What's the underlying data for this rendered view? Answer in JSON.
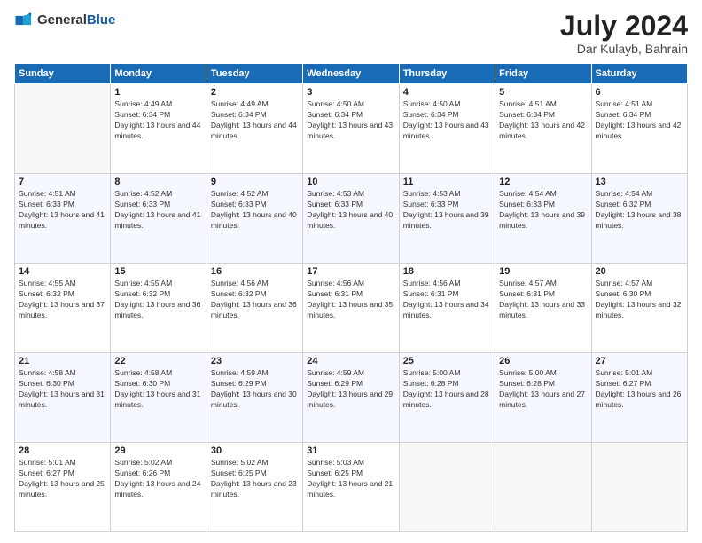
{
  "header": {
    "logo_general": "General",
    "logo_blue": "Blue",
    "month": "July 2024",
    "location": "Dar Kulayb, Bahrain"
  },
  "weekdays": [
    "Sunday",
    "Monday",
    "Tuesday",
    "Wednesday",
    "Thursday",
    "Friday",
    "Saturday"
  ],
  "weeks": [
    [
      {
        "day": "",
        "empty": true
      },
      {
        "day": "1",
        "sunrise": "4:49 AM",
        "sunset": "6:34 PM",
        "daylight": "13 hours and 44 minutes."
      },
      {
        "day": "2",
        "sunrise": "4:49 AM",
        "sunset": "6:34 PM",
        "daylight": "13 hours and 44 minutes."
      },
      {
        "day": "3",
        "sunrise": "4:50 AM",
        "sunset": "6:34 PM",
        "daylight": "13 hours and 43 minutes."
      },
      {
        "day": "4",
        "sunrise": "4:50 AM",
        "sunset": "6:34 PM",
        "daylight": "13 hours and 43 minutes."
      },
      {
        "day": "5",
        "sunrise": "4:51 AM",
        "sunset": "6:34 PM",
        "daylight": "13 hours and 42 minutes."
      },
      {
        "day": "6",
        "sunrise": "4:51 AM",
        "sunset": "6:34 PM",
        "daylight": "13 hours and 42 minutes."
      }
    ],
    [
      {
        "day": "7",
        "sunrise": "4:51 AM",
        "sunset": "6:33 PM",
        "daylight": "13 hours and 41 minutes."
      },
      {
        "day": "8",
        "sunrise": "4:52 AM",
        "sunset": "6:33 PM",
        "daylight": "13 hours and 41 minutes."
      },
      {
        "day": "9",
        "sunrise": "4:52 AM",
        "sunset": "6:33 PM",
        "daylight": "13 hours and 40 minutes."
      },
      {
        "day": "10",
        "sunrise": "4:53 AM",
        "sunset": "6:33 PM",
        "daylight": "13 hours and 40 minutes."
      },
      {
        "day": "11",
        "sunrise": "4:53 AM",
        "sunset": "6:33 PM",
        "daylight": "13 hours and 39 minutes."
      },
      {
        "day": "12",
        "sunrise": "4:54 AM",
        "sunset": "6:33 PM",
        "daylight": "13 hours and 39 minutes."
      },
      {
        "day": "13",
        "sunrise": "4:54 AM",
        "sunset": "6:32 PM",
        "daylight": "13 hours and 38 minutes."
      }
    ],
    [
      {
        "day": "14",
        "sunrise": "4:55 AM",
        "sunset": "6:32 PM",
        "daylight": "13 hours and 37 minutes."
      },
      {
        "day": "15",
        "sunrise": "4:55 AM",
        "sunset": "6:32 PM",
        "daylight": "13 hours and 36 minutes."
      },
      {
        "day": "16",
        "sunrise": "4:56 AM",
        "sunset": "6:32 PM",
        "daylight": "13 hours and 36 minutes."
      },
      {
        "day": "17",
        "sunrise": "4:56 AM",
        "sunset": "6:31 PM",
        "daylight": "13 hours and 35 minutes."
      },
      {
        "day": "18",
        "sunrise": "4:56 AM",
        "sunset": "6:31 PM",
        "daylight": "13 hours and 34 minutes."
      },
      {
        "day": "19",
        "sunrise": "4:57 AM",
        "sunset": "6:31 PM",
        "daylight": "13 hours and 33 minutes."
      },
      {
        "day": "20",
        "sunrise": "4:57 AM",
        "sunset": "6:30 PM",
        "daylight": "13 hours and 32 minutes."
      }
    ],
    [
      {
        "day": "21",
        "sunrise": "4:58 AM",
        "sunset": "6:30 PM",
        "daylight": "13 hours and 31 minutes."
      },
      {
        "day": "22",
        "sunrise": "4:58 AM",
        "sunset": "6:30 PM",
        "daylight": "13 hours and 31 minutes."
      },
      {
        "day": "23",
        "sunrise": "4:59 AM",
        "sunset": "6:29 PM",
        "daylight": "13 hours and 30 minutes."
      },
      {
        "day": "24",
        "sunrise": "4:59 AM",
        "sunset": "6:29 PM",
        "daylight": "13 hours and 29 minutes."
      },
      {
        "day": "25",
        "sunrise": "5:00 AM",
        "sunset": "6:28 PM",
        "daylight": "13 hours and 28 minutes."
      },
      {
        "day": "26",
        "sunrise": "5:00 AM",
        "sunset": "6:28 PM",
        "daylight": "13 hours and 27 minutes."
      },
      {
        "day": "27",
        "sunrise": "5:01 AM",
        "sunset": "6:27 PM",
        "daylight": "13 hours and 26 minutes."
      }
    ],
    [
      {
        "day": "28",
        "sunrise": "5:01 AM",
        "sunset": "6:27 PM",
        "daylight": "13 hours and 25 minutes."
      },
      {
        "day": "29",
        "sunrise": "5:02 AM",
        "sunset": "6:26 PM",
        "daylight": "13 hours and 24 minutes."
      },
      {
        "day": "30",
        "sunrise": "5:02 AM",
        "sunset": "6:25 PM",
        "daylight": "13 hours and 23 minutes."
      },
      {
        "day": "31",
        "sunrise": "5:03 AM",
        "sunset": "6:25 PM",
        "daylight": "13 hours and 21 minutes."
      },
      {
        "day": "",
        "empty": true
      },
      {
        "day": "",
        "empty": true
      },
      {
        "day": "",
        "empty": true
      }
    ]
  ]
}
